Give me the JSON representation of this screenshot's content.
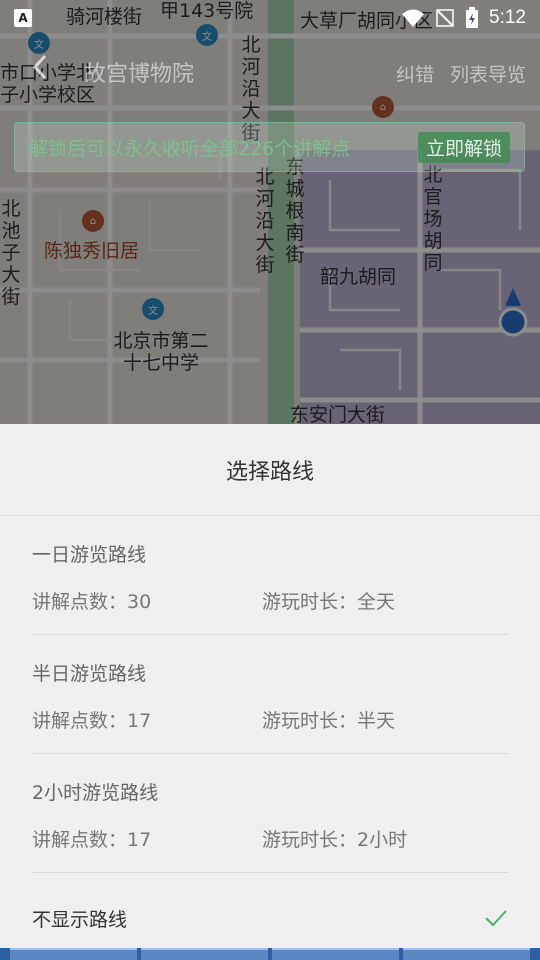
{
  "status_bar": {
    "app_badge": "A",
    "time": "5:12"
  },
  "map": {
    "labels": [
      "骑河楼街",
      "甲143号院",
      "大草厂胡同小区",
      "市口小学北",
      "子小学校区",
      "北河沿大街",
      "东城根南街",
      "北河沿大街",
      "北官场胡同",
      "北池子大街",
      "陈独秀旧居",
      "韶九胡同",
      "北京市第二十七中学",
      "东安门大街"
    ]
  },
  "header": {
    "title": "故宫博物院",
    "actions": [
      "纠错",
      "列表导览"
    ]
  },
  "banner": {
    "text": "解锁后可以永久收听全部226个讲解点",
    "button": "立即解锁"
  },
  "sheet": {
    "title": "选择路线",
    "routes": [
      {
        "name": "一日游览路线",
        "count": "讲解点数：30",
        "duration": "游玩时长：全天"
      },
      {
        "name": "半日游览路线",
        "count": "讲解点数：17",
        "duration": "游玩时长：半天"
      },
      {
        "name": "2小时游览路线",
        "count": "讲解点数：17",
        "duration": "游玩时长：2小时"
      }
    ],
    "none_option": "不显示路线"
  },
  "colors": {
    "accent_green": "#4caf6a",
    "overlay": "#000000"
  }
}
